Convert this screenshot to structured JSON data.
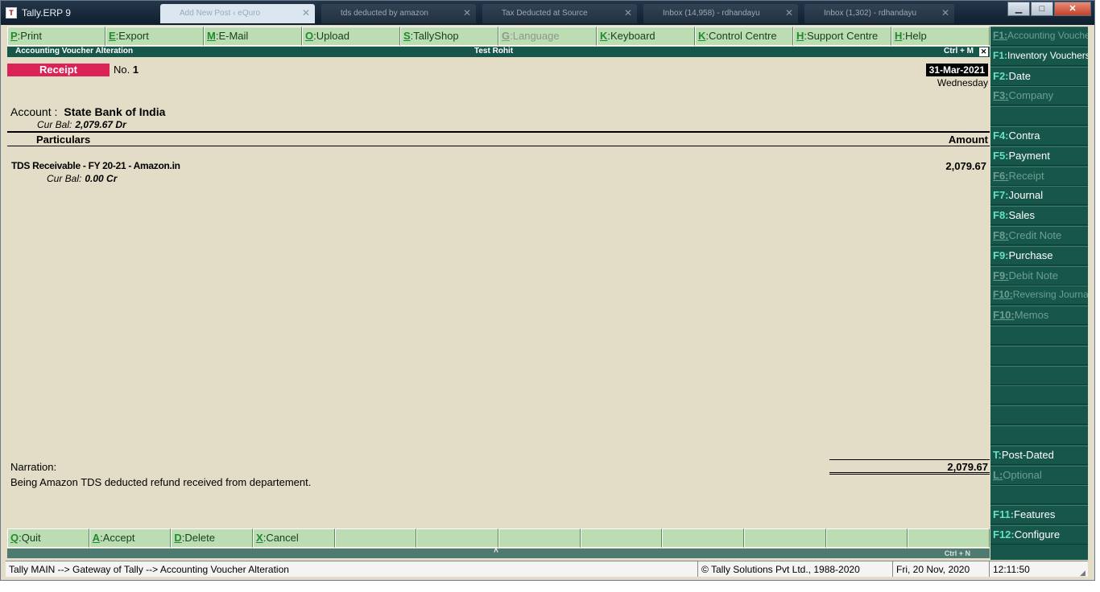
{
  "window": {
    "app_title": "Tally.ERP 9",
    "app_icon": "tally-icon",
    "tabs": [
      {
        "label": "Add New Post ‹ eQuro"
      },
      {
        "label": "tds deducted by amazon"
      },
      {
        "label": "Tax Deducted at Source"
      },
      {
        "label": "Inbox (14,958) - rdhandayu"
      },
      {
        "label": "Inbox (1,302) - rdhandayu"
      }
    ],
    "controls": {
      "minimize": "▁",
      "maximize": "□",
      "close": "✕"
    }
  },
  "top_buttons": [
    {
      "key": "P",
      "label": "Print",
      "enabled": true
    },
    {
      "key": "E",
      "label": "Export",
      "enabled": true
    },
    {
      "key": "M",
      "label": "E-Mail",
      "enabled": true
    },
    {
      "key": "O",
      "label": "Upload",
      "enabled": true
    },
    {
      "key": "S",
      "label": "TallyShop",
      "enabled": true
    },
    {
      "key": "G",
      "label": "Language",
      "enabled": false
    },
    {
      "key": "K",
      "label": "Keyboard",
      "enabled": true
    },
    {
      "key": "K",
      "label": "Control Centre",
      "enabled": true
    },
    {
      "key": "H",
      "label": "Support Centre",
      "enabled": true
    },
    {
      "key": "H",
      "label": "Help",
      "enabled": true
    }
  ],
  "header": {
    "screen_title": "Accounting Voucher  Alteration",
    "company": "Test Rohit",
    "shortcut": "Ctrl + M",
    "close": "✕"
  },
  "voucher": {
    "type": "Receipt",
    "no_label": "No.",
    "number": "1",
    "date": "31-Mar-2021",
    "day": "Wednesday",
    "account_label": "Account :",
    "account": "State Bank of India",
    "cur_bal_label": "Cur Bal:",
    "account_balance": "2,079.67 Dr",
    "col_particulars": "Particulars",
    "col_amount": "Amount",
    "entries": [
      {
        "ledger": "TDS Receivable - FY 20-21 - Amazon.in",
        "amount": "2,079.67",
        "cur_bal_label": "Cur Bal:",
        "balance": "0.00 Cr"
      }
    ],
    "narration_label": "Narration:",
    "narration": "Being Amazon TDS deducted refund received from departement.",
    "total": "2,079.67"
  },
  "bottom_buttons": [
    {
      "key": "Q",
      "label": "Quit"
    },
    {
      "key": "A",
      "label": "Accept"
    },
    {
      "key": "D",
      "label": "Delete"
    },
    {
      "key": "X",
      "label": "Cancel"
    },
    {
      "key": "",
      "label": ""
    },
    {
      "key": "",
      "label": ""
    },
    {
      "key": "",
      "label": ""
    },
    {
      "key": "",
      "label": ""
    },
    {
      "key": "",
      "label": ""
    },
    {
      "key": "",
      "label": ""
    },
    {
      "key": "",
      "label": ""
    },
    {
      "key": "",
      "label": ""
    }
  ],
  "bottom_strip": {
    "caret": "^",
    "shortcut": "Ctrl + N"
  },
  "sidebar": [
    {
      "key": "F1",
      "label": "Accounting Vouchers",
      "enabled": false
    },
    {
      "key": "F1",
      "label": "Inventory Vouchers",
      "enabled": true
    },
    {
      "key": "F2",
      "label": "Date",
      "enabled": true
    },
    {
      "key": "F3",
      "label": "Company",
      "enabled": false
    },
    {
      "key": "",
      "label": "",
      "enabled": false
    },
    {
      "key": "F4",
      "label": "Contra",
      "enabled": true
    },
    {
      "key": "F5",
      "label": "Payment",
      "enabled": true
    },
    {
      "key": "F6",
      "label": "Receipt",
      "enabled": false
    },
    {
      "key": "F7",
      "label": "Journal",
      "enabled": true
    },
    {
      "key": "F8",
      "label": "Sales",
      "enabled": true
    },
    {
      "key": "F8",
      "label": "Credit Note",
      "enabled": false
    },
    {
      "key": "F9",
      "label": "Purchase",
      "enabled": true
    },
    {
      "key": "F9",
      "label": "Debit Note",
      "enabled": false
    },
    {
      "key": "F10",
      "label": "Reversing Journal",
      "enabled": false
    },
    {
      "key": "F10",
      "label": "Memos",
      "enabled": false
    },
    {
      "key": "",
      "label": "",
      "enabled": false
    },
    {
      "key": "",
      "label": "",
      "enabled": false
    },
    {
      "key": "",
      "label": "",
      "enabled": false
    },
    {
      "key": "",
      "label": "",
      "enabled": false
    },
    {
      "key": "",
      "label": "",
      "enabled": false
    },
    {
      "key": "",
      "label": "",
      "enabled": false
    },
    {
      "key": "T",
      "label": "Post-Dated",
      "enabled": true
    },
    {
      "key": "L",
      "label": "Optional",
      "enabled": false
    },
    {
      "key": "",
      "label": "",
      "enabled": false
    },
    {
      "key": "F11",
      "label": "Features",
      "enabled": true
    },
    {
      "key": "F12",
      "label": "Configure",
      "enabled": true
    }
  ],
  "status_bar": {
    "breadcrumb": "Tally MAIN --> Gateway of Tally --> Accounting Voucher  Alteration",
    "copyright": "© Tally Solutions Pvt Ltd., 1988-2020",
    "date": "Fri, 20 Nov, 2020",
    "time": "12:11:50"
  }
}
